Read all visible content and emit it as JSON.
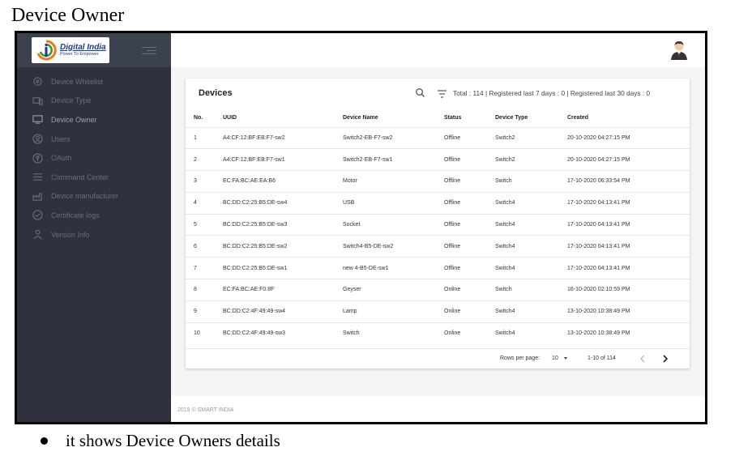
{
  "doc": {
    "title": "Device Owner",
    "bullet": "it shows Device Owners details"
  },
  "brand": {
    "name": "Digital India",
    "tagline": "Power To Empower"
  },
  "sidebar": {
    "items": [
      {
        "label": "Device Whitelist",
        "icon": "circle-icon"
      },
      {
        "label": "Device Type",
        "icon": "devices-icon"
      },
      {
        "label": "Device Owner",
        "icon": "monitor-icon"
      },
      {
        "label": "Users",
        "icon": "user-circle-icon"
      },
      {
        "label": "OAuth",
        "icon": "key-icon"
      },
      {
        "label": "Command Center",
        "icon": "list-icon"
      },
      {
        "label": "Device manufacturer",
        "icon": "factory-icon"
      },
      {
        "label": "Certificate logs",
        "icon": "certificate-icon"
      },
      {
        "label": "Version Info",
        "icon": "info-user-icon"
      }
    ],
    "active_index": 2
  },
  "card": {
    "title": "Devices",
    "summary": "Total : 114 | Registered last 7 days : 0 | Registered last 30 days : 0"
  },
  "table": {
    "columns": [
      "No.",
      "UUID",
      "Device Name",
      "Status",
      "Device Type",
      "Created"
    ],
    "rows": [
      [
        "1",
        "A4:CF:12:BF:EB:F7-sw2",
        "Switch2-EB-F7-sw2",
        "Offline",
        "Switch2",
        "20-10-2020 04:27:15 PM"
      ],
      [
        "2",
        "A4:CF:12:BF:EB:F7-sw1",
        "Switch2-EB-F7-sw1",
        "Offline",
        "Switch2",
        "20-10-2020 04:27:15 PM"
      ],
      [
        "3",
        "EC:FA:BC:AE:EA:B6",
        "Motor",
        "Offline",
        "Switch",
        "17-10-2020 06:33:54 PM"
      ],
      [
        "4",
        "BC:DD:C2:25:B5:DE-sw4",
        "USB",
        "Offline",
        "Switch4",
        "17-10-2020 04:13:41 PM"
      ],
      [
        "5",
        "BC:DD:C2:25:B5:DE-sw3",
        "Socket",
        "Offline",
        "Switch4",
        "17-10-2020 04:13:41 PM"
      ],
      [
        "6",
        "BC:DD:C2:25:B5:DE-sw2",
        "Switch4-B5-DE-sw2",
        "Offline",
        "Switch4",
        "17-10-2020 04:13:41 PM"
      ],
      [
        "7",
        "BC:DD:C2:25:B5:DE-sw1",
        "new 4-B5-DE-sw1",
        "Offline",
        "Switch4",
        "17-10-2020 04:13:41 PM"
      ],
      [
        "8",
        "EC:FA:BC:AE:F0:8F",
        "Geyser",
        "Online",
        "Switch",
        "16-10-2020 02:10:59 PM"
      ],
      [
        "9",
        "BC:DD:C2:4F:49:49-sw4",
        "Lamp",
        "Online",
        "Switch4",
        "13-10-2020 10:38:49 PM"
      ],
      [
        "10",
        "BC:DD:C2:4F:49:49-sw3",
        "Switch",
        "Online",
        "Switch4",
        "13-10-2020 10:38:49 PM"
      ]
    ]
  },
  "pagination": {
    "rows_per_page_label": "Rows per page:",
    "rows_per_page": "10",
    "range": "1-10 of 114"
  },
  "footer": {
    "copyright": "2019 © SMART INDIA"
  },
  "colors": {
    "sidebar_bg": "#2f323e",
    "sidebar_text": "#666c7c",
    "brand_blue": "#1b3b8f",
    "brand_orange": "#f07a1a",
    "brand_green": "#2e9a3a"
  }
}
